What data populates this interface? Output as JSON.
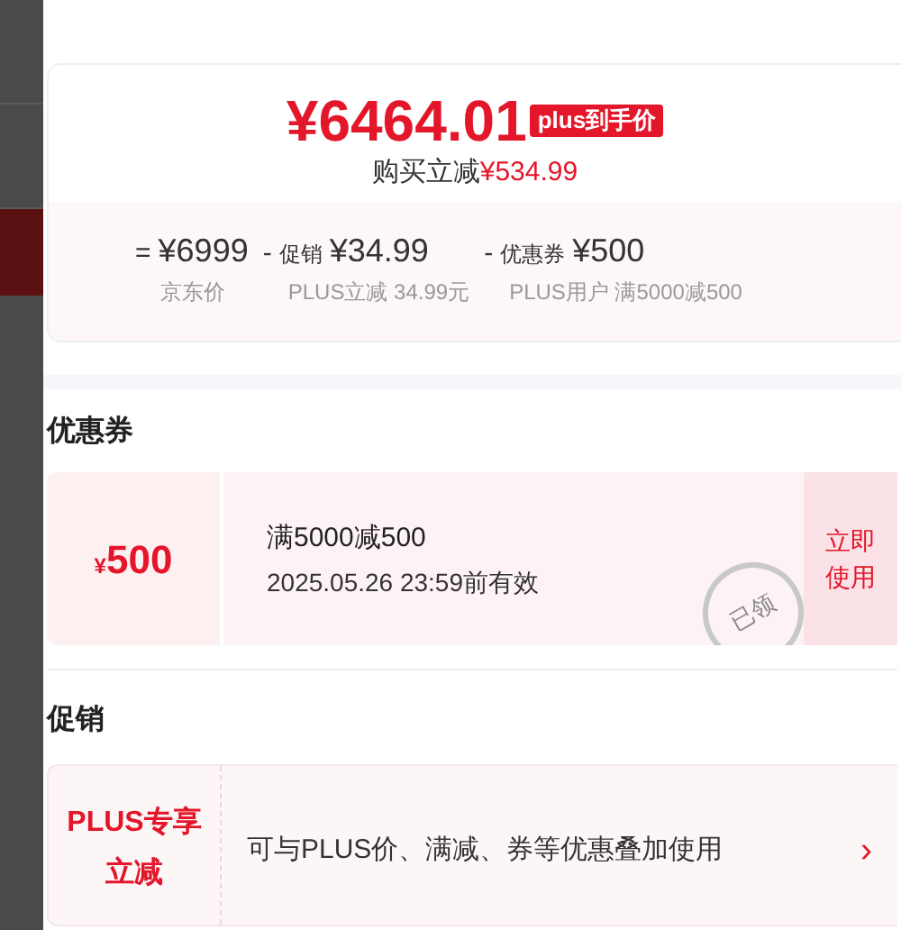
{
  "price_card": {
    "final_price": "¥6464.01",
    "price_badge": "plus到手价",
    "saving_label": "购买立减",
    "saving_amount": "¥534.99",
    "breakdown": [
      {
        "operator": "=",
        "amount": "¥6999",
        "caption": "京东价"
      },
      {
        "operator": "-",
        "prefix": "促销",
        "amount": "¥34.99",
        "caption": "PLUS立减 34.99元"
      },
      {
        "operator": "-",
        "prefix": "优惠券",
        "amount": "¥500",
        "caption": "PLUS用户 满5000减500"
      }
    ]
  },
  "coupon_section": {
    "title": "优惠券",
    "coupons": [
      {
        "amount_symbol": "¥",
        "amount": "500",
        "condition": "满5000减500",
        "validity": "2025.05.26 23:59前有效",
        "stamp": "已领",
        "claimed": true,
        "action": "立即使用"
      }
    ]
  },
  "promo_section": {
    "title": "促销",
    "promos": [
      {
        "tag": "PLUS专享立减",
        "description": "可与PLUS价、满减、券等优惠叠加使用",
        "chevron": "›"
      }
    ]
  }
}
